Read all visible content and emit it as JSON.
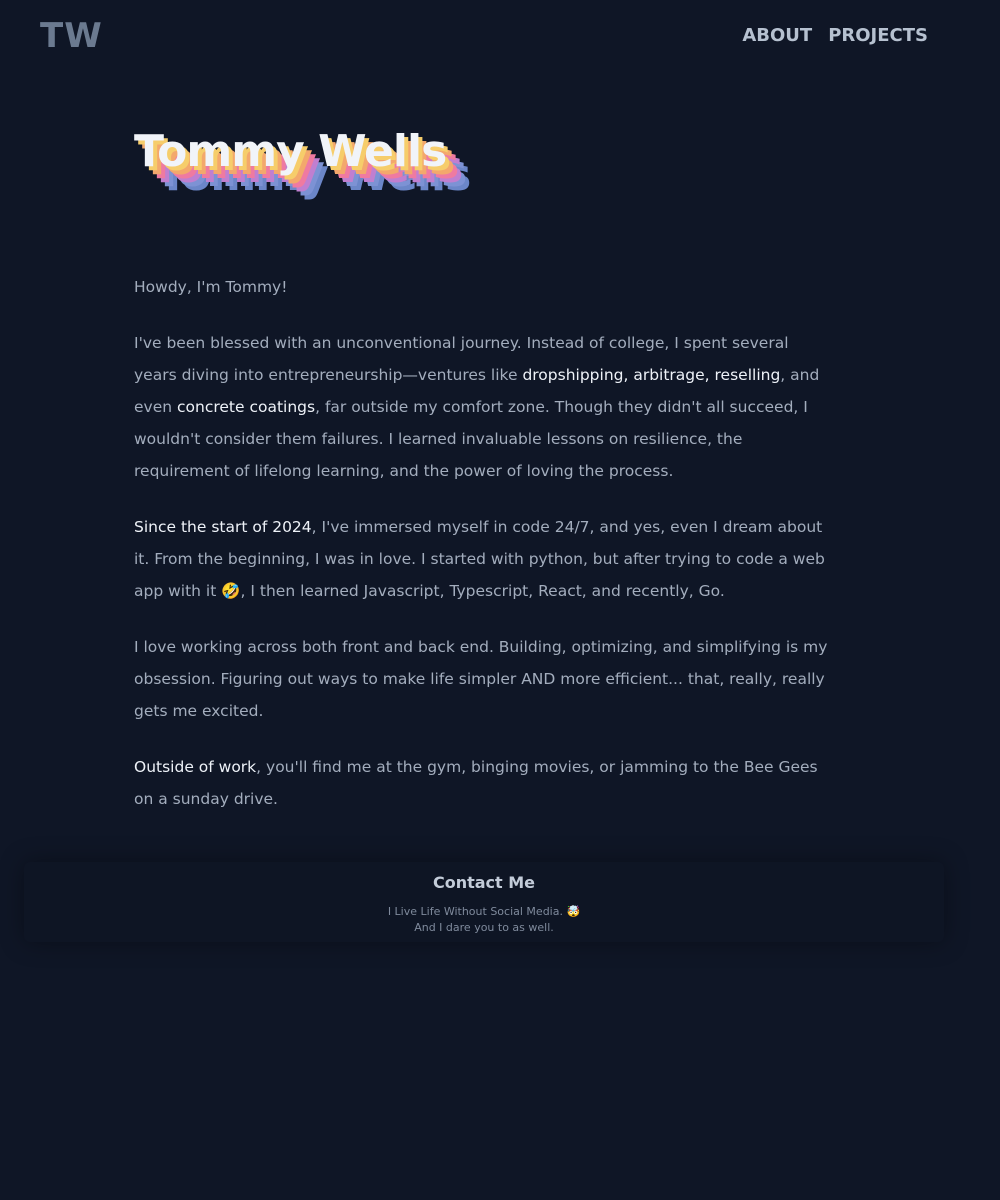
{
  "header": {
    "logo": "TW",
    "nav": [
      {
        "label": "ABOUT"
      },
      {
        "label": "PROJECTS"
      }
    ]
  },
  "hero": {
    "name": "Tommy Wells"
  },
  "about": {
    "greeting": "Howdy, I'm Tommy!",
    "p1": {
      "before": "I've been blessed with an unconventional journey. Instead of college, I spent several years diving into entrepreneurship—ventures like ",
      "highlight1": "dropshipping, arbitrage, reselling",
      "middle": ", and even ",
      "highlight2": "concrete coatings",
      "after": ", far outside my comfort zone. Though they didn't all succeed, I wouldn't consider them failures. I learned invaluable lessons on resilience, the requirement of lifelong learning, and the power of loving the process."
    },
    "p2": {
      "highlight": "Since the start of 2024",
      "after_highlight": ", I've immersed myself in code 24/7, and yes, even I dream about it. From the beginning, I was in love. I started with python, but after trying to code a web app with it ",
      "emoji": "🤣",
      "after_emoji": ", I then learned Javascript, Typescript, React, and recently, Go."
    },
    "p3": "I love working across both front and back end. Building, optimizing, and simplifying is my obsession. Figuring out ways to make life simpler AND more efficient... that, really, really gets me excited.",
    "p4": {
      "highlight": "Outside of work",
      "after": ", you'll find me at the gym, binging movies, or jamming to the Bee Gees on a sunday drive."
    }
  },
  "contact": {
    "title": "Contact Me",
    "line1": "I Live Life Without Social Media. 🤯",
    "line2": "And I dare you to as well."
  },
  "colors": {
    "background": "#0f1626",
    "text": "#a3adbd",
    "highlight": "#eef2f8",
    "logo": "#6b7a90"
  }
}
